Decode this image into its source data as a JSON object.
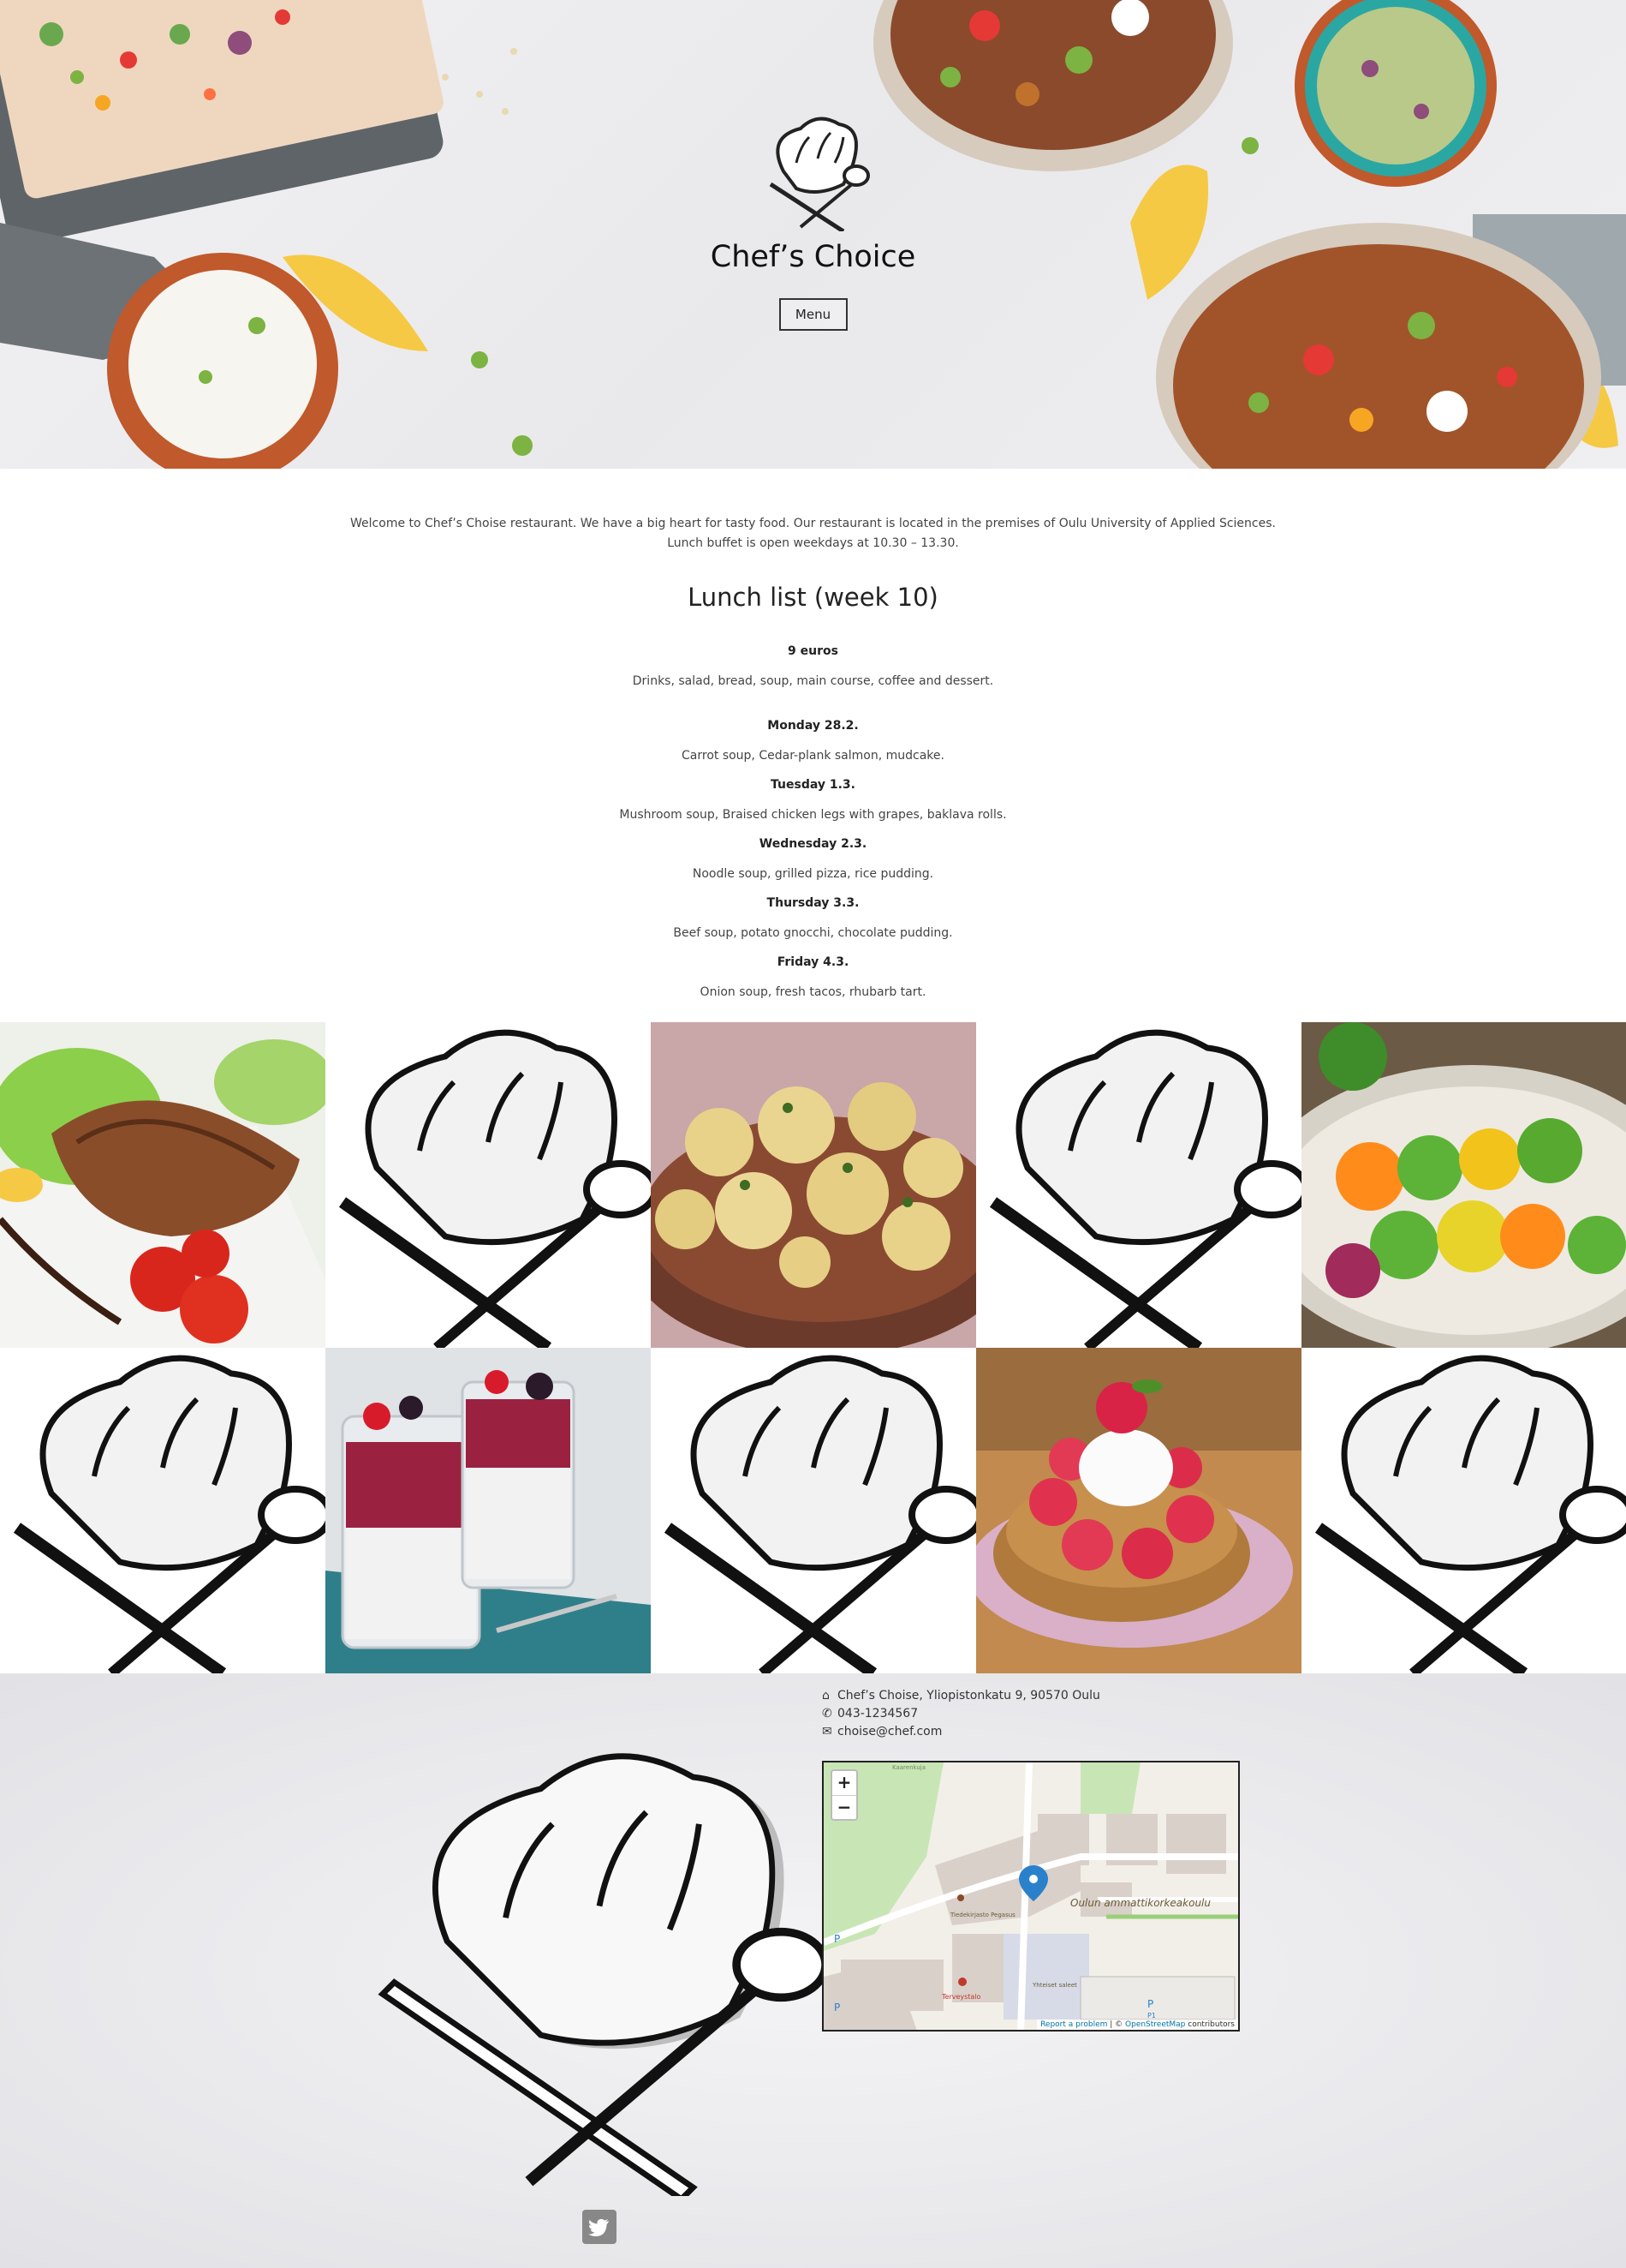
{
  "hero": {
    "title": "Chef’s Choice",
    "menu_button": "Menu"
  },
  "intro": {
    "line1": "Welcome to Chef’s Choise restaurant. We have a big heart for tasty food. Our restaurant is located in the premises of Oulu University of Applied Sciences.",
    "line2": "Lunch buffet is open weekdays at 10.30 – 13.30."
  },
  "lunch": {
    "title": "Lunch list (week 10)",
    "price": "9 euros",
    "includes": "Drinks, salad, bread, soup, main course, coffee and dessert.",
    "days": [
      {
        "day": "Monday 28.2.",
        "menu": "Carrot soup, Cedar-plank salmon, mudcake."
      },
      {
        "day": "Tuesday 1.3.",
        "menu": "Mushroom soup, Braised chicken legs with grapes, baklava rolls."
      },
      {
        "day": "Wednesday 2.3.",
        "menu": "Noodle soup, grilled pizza, rice pudding."
      },
      {
        "day": "Thursday 3.3.",
        "menu": "Beef soup, potato gnocchi, chocolate pudding."
      },
      {
        "day": "Friday 4.3.",
        "menu": "Onion soup, fresh tacos, rhubarb tart."
      }
    ]
  },
  "gallery": {
    "tiles": [
      "salmon-photo",
      "chef-logo",
      "potatoes-photo",
      "chef-logo",
      "vegetable-skewers-photo",
      "chef-logo",
      "berry-parfait-photo",
      "chef-logo",
      "raspberry-tart-photo",
      "chef-logo"
    ]
  },
  "footer": {
    "address": "Chef’s Choise, Yliopistonkatu 9, 90570 Oulu",
    "phone": "043-1234567",
    "email": "choise@chef.com",
    "map": {
      "zoom_in": "+",
      "zoom_out": "−",
      "label_university": "Oulun ammattikorkeakoulu",
      "label_pegasus": "Tiedekirjasto Pegasus",
      "label_terveys": "Terveystalo",
      "label_yhteiset": "Yhteiset saleet",
      "label_p1": "P",
      "label_p1_sub": "P1",
      "label_kaarti": "Kaarenkuja",
      "attribution_report": "Report a problem",
      "attribution_sep": " | © ",
      "attribution_osm": "OpenStreetMap",
      "attribution_tail": " contributors"
    }
  },
  "colors": {
    "map_road": "#ffffff",
    "map_building": "#d9d0c9",
    "map_green": "#c8e6b5",
    "map_marker": "#2a81cb",
    "twitter_icon_bg": "#888888"
  }
}
